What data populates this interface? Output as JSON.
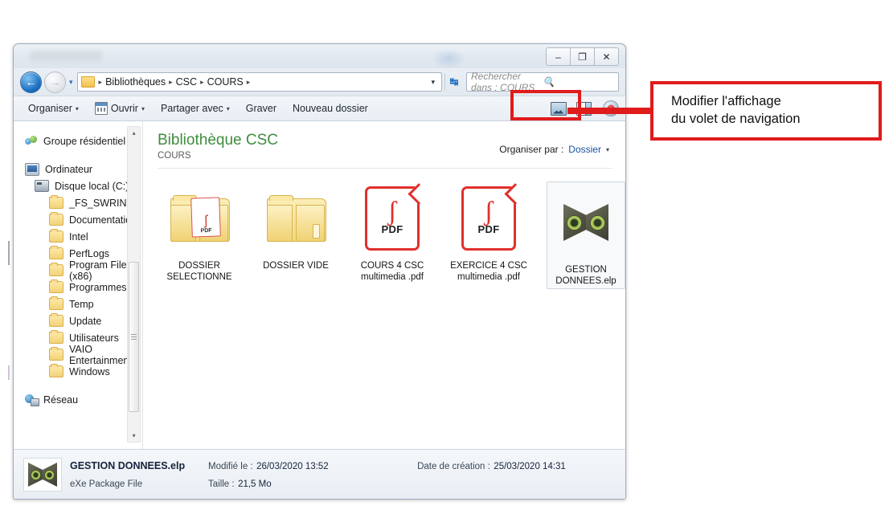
{
  "window": {
    "controls": {
      "minimize": "–",
      "maximize": "❐",
      "close": "✕"
    }
  },
  "address": {
    "back_icon": "back-arrow",
    "forward_icon": "forward-arrow",
    "history_caret": "▾",
    "folder_icon": "folder-icon",
    "breadcrumbs": [
      "Bibliothèques",
      "CSC",
      "COURS"
    ],
    "separator": "▸",
    "dropdown_caret": "▾",
    "refresh_icon": "↺",
    "search": {
      "placeholder": "Rechercher dans : COURS",
      "icon": "magnifier-icon"
    }
  },
  "toolbar": {
    "organiser": "Organiser",
    "ouvrir": "Ouvrir",
    "partager": "Partager avec",
    "graver": "Graver",
    "nouveau_dossier": "Nouveau dossier",
    "caret": "▾",
    "view_icon": "change-view-icon",
    "view_caret": "▾",
    "preview_pane_icon": "navigation-pane-icon",
    "help_icon": "help-icon"
  },
  "navigation": {
    "items": [
      {
        "label": "Groupe résidentiel",
        "icon": "homegroup-icon",
        "level": 0
      },
      {
        "label": "Ordinateur",
        "icon": "computer-icon",
        "level": 0
      },
      {
        "label": "Disque local (C:)",
        "icon": "drive-icon",
        "level": 1
      },
      {
        "label": "_FS_SWRINFO",
        "icon": "folder-icon",
        "level": 2
      },
      {
        "label": "Documentation",
        "icon": "folder-icon",
        "level": 2
      },
      {
        "label": "Intel",
        "icon": "folder-icon",
        "level": 2
      },
      {
        "label": "PerfLogs",
        "icon": "folder-icon",
        "level": 2
      },
      {
        "label": "Program Files (x86)",
        "icon": "folder-icon",
        "level": 2
      },
      {
        "label": "Programmes",
        "icon": "folder-icon",
        "level": 2
      },
      {
        "label": "Temp",
        "icon": "folder-icon",
        "level": 2
      },
      {
        "label": "Update",
        "icon": "folder-icon",
        "level": 2
      },
      {
        "label": "Utilisateurs",
        "icon": "folder-icon",
        "level": 2
      },
      {
        "label": "VAIO Entertainment",
        "icon": "folder-icon",
        "level": 2
      },
      {
        "label": "Windows",
        "icon": "folder-icon",
        "level": 2
      },
      {
        "label": "Réseau",
        "icon": "network-icon",
        "level": 0
      }
    ],
    "scroll_up": "▴",
    "scroll_down": "▾"
  },
  "library": {
    "title": "Bibliothèque CSC",
    "subtitle": "COURS",
    "organize_label": "Organiser par :",
    "organize_value": "Dossier",
    "organize_caret": "▾"
  },
  "files": [
    {
      "name_line1": "DOSSIER",
      "name_line2": "SELECTIONNE",
      "icon": "folder-with-pdf-icon",
      "selected": false
    },
    {
      "name_line1": "DOSSIER VIDE",
      "name_line2": "",
      "icon": "empty-folder-icon",
      "selected": false
    },
    {
      "name_line1": "COURS 4 CSC",
      "name_line2": "multimedia .pdf",
      "icon": "pdf-icon",
      "selected": false
    },
    {
      "name_line1": "EXERCICE 4 CSC",
      "name_line2": "multimedia .pdf",
      "icon": "pdf-icon",
      "selected": false
    },
    {
      "name_line1": "GESTION",
      "name_line2": "DONNEES.elp",
      "icon": "exe-package-icon",
      "selected": true
    }
  ],
  "pdf_glyph": {
    "acrobat": "ʃ",
    "text": "PDF"
  },
  "status": {
    "file_name": "GESTION DONNEES.elp",
    "file_type": "eXe Package File",
    "modified_label": "Modifié le :",
    "modified_value": "26/03/2020 13:52",
    "size_label": "Taille :",
    "size_value": "21,5 Mo",
    "created_label": "Date de création :",
    "created_value": "25/03/2020 14:31"
  },
  "annotation": {
    "line1": "Modifier l'affichage",
    "line2": "du volet de navigation",
    "color": "#e01b1b"
  }
}
